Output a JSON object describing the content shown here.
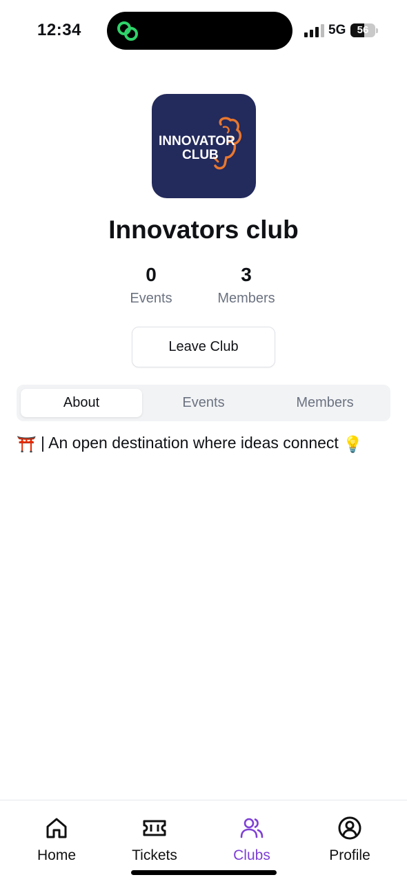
{
  "status_bar": {
    "time": "12:34",
    "network": "5G",
    "battery_percent": 56,
    "battery_label": "56"
  },
  "club": {
    "logo_line1": "INNOVATOR",
    "logo_line2": "CLUB",
    "name": "Innovators club",
    "stats": {
      "events_value": "0",
      "events_label": "Events",
      "members_value": "3",
      "members_label": "Members"
    },
    "leave_label": "Leave Club"
  },
  "tabs": [
    {
      "label": "About",
      "selected": true
    },
    {
      "label": "Events",
      "selected": false
    },
    {
      "label": "Members",
      "selected": false
    }
  ],
  "about": {
    "emoji_start": "⛩️",
    "text": " | An open destination where ideas connect",
    "emoji_end": "💡"
  },
  "nav": {
    "items": [
      {
        "label": "Home",
        "icon": "home-icon"
      },
      {
        "label": "Tickets",
        "icon": "ticket-icon"
      },
      {
        "label": "Clubs",
        "icon": "users-icon",
        "active": true
      },
      {
        "label": "Profile",
        "icon": "user-circle-icon"
      }
    ],
    "active_color": "#7e3fd6"
  },
  "colors": {
    "logo_bg": "#232a5c",
    "logo_accent": "#e8772e",
    "island_icon": "#2fd36a"
  }
}
